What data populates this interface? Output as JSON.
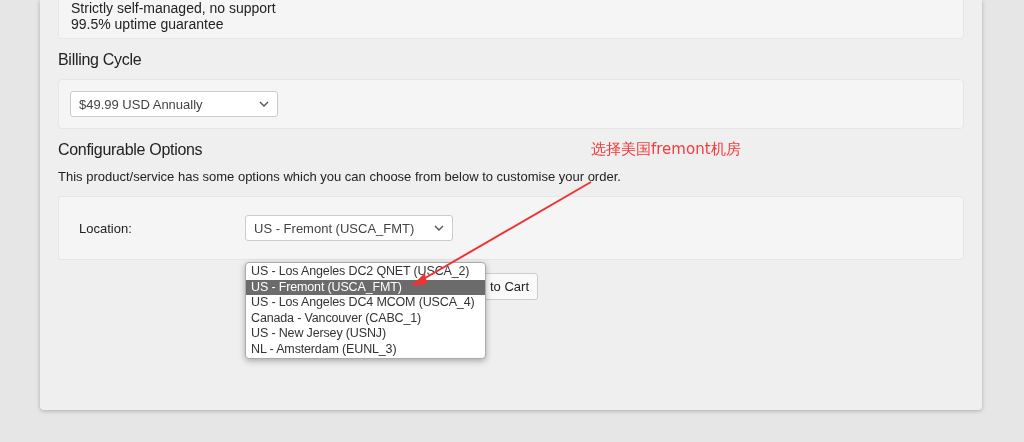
{
  "features": [
    "Strictly self-managed, no support",
    "99.5% uptime guarantee"
  ],
  "billing": {
    "heading": "Billing Cycle",
    "value": "$49.99 USD Annually"
  },
  "options": {
    "heading": "Configurable Options",
    "description": "This product/service has some options which you can choose from below to customise your order.",
    "label": "Location:",
    "value": "US - Fremont (USCA_FMT)",
    "dropdown": [
      {
        "label": "US - Los Angeles DC2 QNET (USCA_2)",
        "selected": false
      },
      {
        "label": "US - Fremont (USCA_FMT)",
        "selected": true
      },
      {
        "label": "US - Los Angeles DC4 MCOM (USCA_4)",
        "selected": false
      },
      {
        "label": "Canada - Vancouver (CABC_1)",
        "selected": false
      },
      {
        "label": "US - New Jersey (USNJ)",
        "selected": false
      },
      {
        "label": "NL - Amsterdam (EUNL_3)",
        "selected": false
      }
    ]
  },
  "cart_button": "to Cart",
  "annotation": "选择美国fremont机房"
}
